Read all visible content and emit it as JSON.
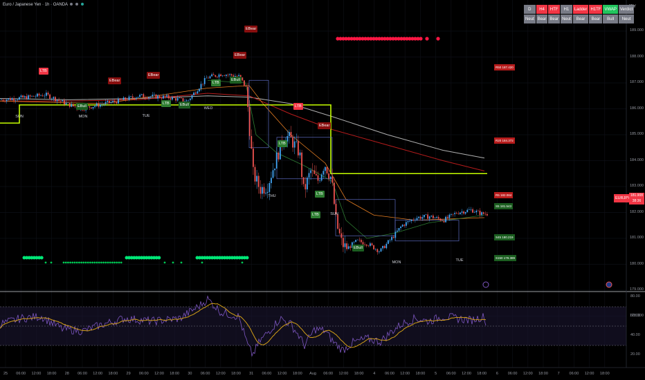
{
  "header": {
    "symbol_title": "Euro / Japanese Yen · 1h · OANDA",
    "currency": "JPY",
    "dots": [
      "#787b86",
      "#787b86",
      "#26a69a"
    ]
  },
  "verdict_table": {
    "headers": [
      "D",
      "H4",
      "HTF",
      "H1",
      "Ladder",
      "H1TF",
      "VWAP",
      "Verdict"
    ],
    "header_colors": [
      "#787b86",
      "#f23645",
      "#f23645",
      "#787b86",
      "#f23645",
      "#f23645",
      "#22c55e",
      "#787b86"
    ],
    "values": [
      "Neut",
      "Bear",
      "Bear",
      "Neut",
      "Bear",
      "Bear",
      "Bull",
      "Neut"
    ],
    "value_colors": [
      "#787b86",
      "#787b86",
      "#787b86",
      "#787b86",
      "#787b86",
      "#787b86",
      "#787b86",
      "#787b86"
    ]
  },
  "price_axis": {
    "labels": [
      "189.000",
      "188.000",
      "187.000",
      "186.000",
      "185.000",
      "184.000",
      "183.000",
      "182.000",
      "181.000",
      "180.000",
      "179.000",
      "178.000"
    ]
  },
  "current_price": {
    "symbol": "EURJPY",
    "price": "181.908",
    "countdown": "38:36"
  },
  "levels": [
    {
      "text": "R50 187.420",
      "color": "#b71c1c"
    },
    {
      "text": "R20 184.372",
      "color": "#b71c1c"
    },
    {
      "text": "R5 182.084",
      "color": "#b71c1c"
    },
    {
      "text": "S5 181.543",
      "color": "#1b5e20"
    },
    {
      "text": "S45 180.219",
      "color": "#1b5e20"
    },
    {
      "text": "S150 179.389",
      "color": "#1b5e20"
    }
  ],
  "markers": [
    {
      "text": "LTB",
      "color": "#f23645"
    },
    {
      "text": "EBear",
      "color": "#880e0e"
    },
    {
      "text": "EBear",
      "color": "#880e0e"
    },
    {
      "text": "EBear",
      "color": "#880e0e"
    },
    {
      "text": "EBear",
      "color": "#880e0e"
    },
    {
      "text": "EBull",
      "color": "#1b5e20"
    },
    {
      "text": "LTB",
      "color": "#2e7d32"
    },
    {
      "text": "EBull",
      "color": "#1b5e20"
    },
    {
      "text": "LTB",
      "color": "#2e7d32"
    },
    {
      "text": "EBull",
      "color": "#1b5e20"
    },
    {
      "text": "LTB",
      "color": "#f23645"
    },
    {
      "text": "EBear",
      "color": "#880e0e"
    },
    {
      "text": "LTB",
      "color": "#2e7d32"
    },
    {
      "text": "LTB",
      "color": "#2e7d32"
    },
    {
      "text": "LTB",
      "color": "#2e7d32"
    },
    {
      "text": "EBull",
      "color": "#1b5e20"
    }
  ],
  "day_labels": [
    "SUN",
    "MON",
    "TUE",
    "WED",
    "THU",
    "SUN",
    "MON",
    "TUE"
  ],
  "rsi_axis": {
    "labels": [
      "80.00",
      "60.00",
      "40.00",
      "20.00"
    ]
  },
  "time_axis": {
    "labels": [
      "25",
      "06:00",
      "12:00",
      "18:00",
      "28",
      "06:00",
      "12:00",
      "18:00",
      "29",
      "06:00",
      "12:00",
      "18:00",
      "30",
      "06:00",
      "12:00",
      "18:00",
      "31",
      "06:00",
      "12:00",
      "18:00",
      "Aug",
      "06:00",
      "12:00",
      "18:00",
      "4",
      "06:00",
      "12:00",
      "18:00",
      "5",
      "06:00",
      "12:00",
      "18:00",
      "6",
      "06:00",
      "12:00",
      "18:00",
      "7",
      "06:00",
      "12:00",
      "18:00"
    ]
  },
  "colors": {
    "bull": "#42a5f5",
    "bear": "#ef5350",
    "support_line": "#c6ff00",
    "rsi_line": "#7e57c2",
    "rsi_ma": "#d4a017",
    "ema_white": "#b0b0b0",
    "ema_red": "#b71c1c",
    "ema_orange": "#e67e22",
    "ema_green": "#2e7d32"
  }
}
